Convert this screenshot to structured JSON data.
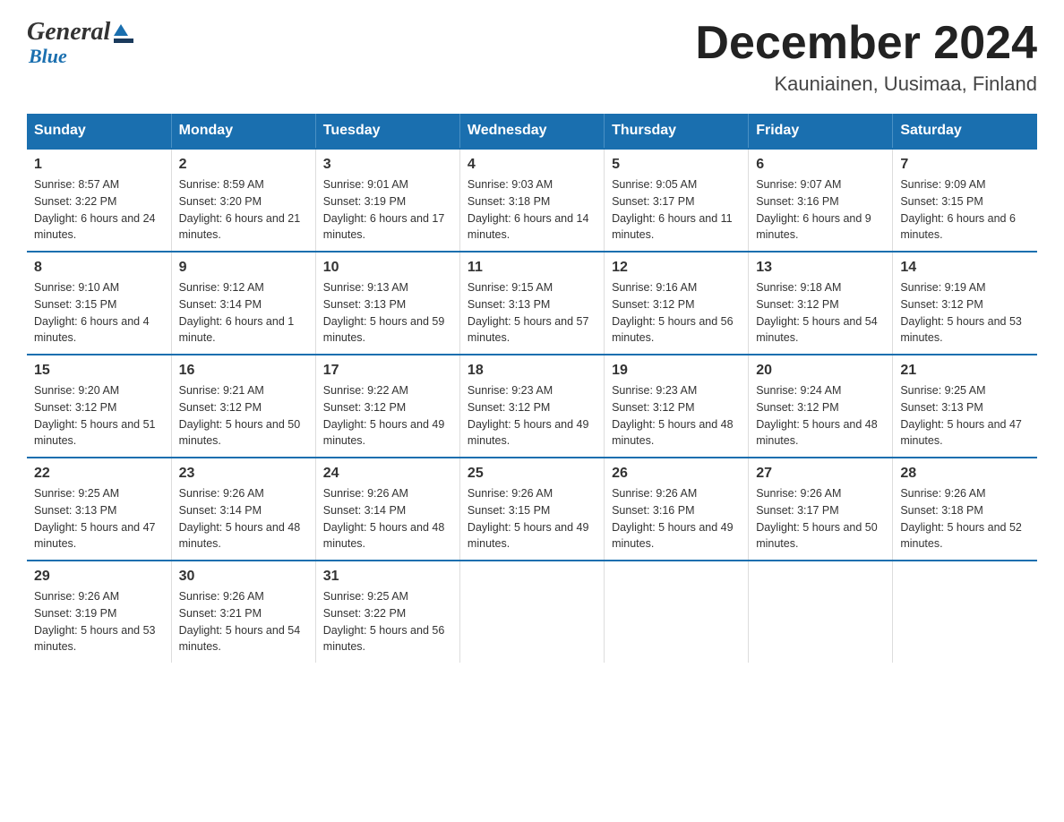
{
  "header": {
    "month_title": "December 2024",
    "location": "Kauniainen, Uusimaa, Finland",
    "logo_general": "General",
    "logo_blue": "Blue"
  },
  "days_of_week": [
    "Sunday",
    "Monday",
    "Tuesday",
    "Wednesday",
    "Thursday",
    "Friday",
    "Saturday"
  ],
  "weeks": [
    [
      {
        "day": "1",
        "sunrise": "8:57 AM",
        "sunset": "3:22 PM",
        "daylight": "6 hours and 24 minutes."
      },
      {
        "day": "2",
        "sunrise": "8:59 AM",
        "sunset": "3:20 PM",
        "daylight": "6 hours and 21 minutes."
      },
      {
        "day": "3",
        "sunrise": "9:01 AM",
        "sunset": "3:19 PM",
        "daylight": "6 hours and 17 minutes."
      },
      {
        "day": "4",
        "sunrise": "9:03 AM",
        "sunset": "3:18 PM",
        "daylight": "6 hours and 14 minutes."
      },
      {
        "day": "5",
        "sunrise": "9:05 AM",
        "sunset": "3:17 PM",
        "daylight": "6 hours and 11 minutes."
      },
      {
        "day": "6",
        "sunrise": "9:07 AM",
        "sunset": "3:16 PM",
        "daylight": "6 hours and 9 minutes."
      },
      {
        "day": "7",
        "sunrise": "9:09 AM",
        "sunset": "3:15 PM",
        "daylight": "6 hours and 6 minutes."
      }
    ],
    [
      {
        "day": "8",
        "sunrise": "9:10 AM",
        "sunset": "3:15 PM",
        "daylight": "6 hours and 4 minutes."
      },
      {
        "day": "9",
        "sunrise": "9:12 AM",
        "sunset": "3:14 PM",
        "daylight": "6 hours and 1 minute."
      },
      {
        "day": "10",
        "sunrise": "9:13 AM",
        "sunset": "3:13 PM",
        "daylight": "5 hours and 59 minutes."
      },
      {
        "day": "11",
        "sunrise": "9:15 AM",
        "sunset": "3:13 PM",
        "daylight": "5 hours and 57 minutes."
      },
      {
        "day": "12",
        "sunrise": "9:16 AM",
        "sunset": "3:12 PM",
        "daylight": "5 hours and 56 minutes."
      },
      {
        "day": "13",
        "sunrise": "9:18 AM",
        "sunset": "3:12 PM",
        "daylight": "5 hours and 54 minutes."
      },
      {
        "day": "14",
        "sunrise": "9:19 AM",
        "sunset": "3:12 PM",
        "daylight": "5 hours and 53 minutes."
      }
    ],
    [
      {
        "day": "15",
        "sunrise": "9:20 AM",
        "sunset": "3:12 PM",
        "daylight": "5 hours and 51 minutes."
      },
      {
        "day": "16",
        "sunrise": "9:21 AM",
        "sunset": "3:12 PM",
        "daylight": "5 hours and 50 minutes."
      },
      {
        "day": "17",
        "sunrise": "9:22 AM",
        "sunset": "3:12 PM",
        "daylight": "5 hours and 49 minutes."
      },
      {
        "day": "18",
        "sunrise": "9:23 AM",
        "sunset": "3:12 PM",
        "daylight": "5 hours and 49 minutes."
      },
      {
        "day": "19",
        "sunrise": "9:23 AM",
        "sunset": "3:12 PM",
        "daylight": "5 hours and 48 minutes."
      },
      {
        "day": "20",
        "sunrise": "9:24 AM",
        "sunset": "3:12 PM",
        "daylight": "5 hours and 48 minutes."
      },
      {
        "day": "21",
        "sunrise": "9:25 AM",
        "sunset": "3:13 PM",
        "daylight": "5 hours and 47 minutes."
      }
    ],
    [
      {
        "day": "22",
        "sunrise": "9:25 AM",
        "sunset": "3:13 PM",
        "daylight": "5 hours and 47 minutes."
      },
      {
        "day": "23",
        "sunrise": "9:26 AM",
        "sunset": "3:14 PM",
        "daylight": "5 hours and 48 minutes."
      },
      {
        "day": "24",
        "sunrise": "9:26 AM",
        "sunset": "3:14 PM",
        "daylight": "5 hours and 48 minutes."
      },
      {
        "day": "25",
        "sunrise": "9:26 AM",
        "sunset": "3:15 PM",
        "daylight": "5 hours and 49 minutes."
      },
      {
        "day": "26",
        "sunrise": "9:26 AM",
        "sunset": "3:16 PM",
        "daylight": "5 hours and 49 minutes."
      },
      {
        "day": "27",
        "sunrise": "9:26 AM",
        "sunset": "3:17 PM",
        "daylight": "5 hours and 50 minutes."
      },
      {
        "day": "28",
        "sunrise": "9:26 AM",
        "sunset": "3:18 PM",
        "daylight": "5 hours and 52 minutes."
      }
    ],
    [
      {
        "day": "29",
        "sunrise": "9:26 AM",
        "sunset": "3:19 PM",
        "daylight": "5 hours and 53 minutes."
      },
      {
        "day": "30",
        "sunrise": "9:26 AM",
        "sunset": "3:21 PM",
        "daylight": "5 hours and 54 minutes."
      },
      {
        "day": "31",
        "sunrise": "9:25 AM",
        "sunset": "3:22 PM",
        "daylight": "5 hours and 56 minutes."
      },
      null,
      null,
      null,
      null
    ]
  ]
}
